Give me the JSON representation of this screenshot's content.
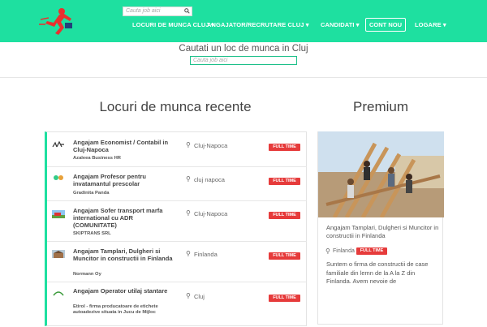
{
  "header": {
    "logo": "logo-runner-icon",
    "search_placeholder": "Cauta job aici",
    "search_icon": "search-icon",
    "nav": [
      {
        "label": "LOCURI DE MUNCA CLUJ",
        "dropdown": true
      },
      {
        "label": "ANGAJATOR/RECRUTARE CLUJ",
        "dropdown": true
      },
      {
        "label": "CANDIDATI",
        "dropdown": true
      }
    ],
    "cta_label": "CONT NOU",
    "login_label": "LOGARE",
    "caret": "▾",
    "accent_color": "#1ee0a0"
  },
  "hero": {
    "title": "Cautati un loc de munca in Cluj",
    "search_placeholder": "Cauta job aici"
  },
  "recent": {
    "title": "Locuri de munca recente",
    "jobs": [
      {
        "title": "Angajam Economist / Contabil in Cluj-Napoca",
        "company": "Azaleea Business HR",
        "location": "Cluj-Napoca",
        "type": "FULL TIME"
      },
      {
        "title": "Angajam Profesor pentru invatamantul prescolar",
        "company": "Gradinita Panda",
        "location": "cluj napoca",
        "type": "FULL TIME"
      },
      {
        "title": "Angajam Sofer transport marfa international cu ADR (COMUNITATE)",
        "company": "SKIPTRANS SRL",
        "location": "Cluj-Napoca",
        "type": "FULL TIME"
      },
      {
        "title": "Angajam Tamplari, Dulgheri si Muncitor in constructii in Finlanda",
        "company": "Normann Oy",
        "location": "Finlanda",
        "type": "FULL TIME"
      },
      {
        "title": "Angajam Operator utilaj stantare",
        "company": "Etirol - firma producatoare de etichete autoadezive situata in Jucu de Mijloc",
        "location": "Cluj",
        "type": "FULL TIME"
      }
    ]
  },
  "premium": {
    "title": "Premium",
    "job_title": "Angajam Tamplari, Dulgheri si Muncitor in constructii in Finlanda",
    "location": "Finlanda",
    "type": "FULL TIME",
    "description": "Suntem o firma de constructii de case familiale din lemn de la A la Z din Finlanda. Avem nevoie de"
  },
  "icons": {
    "pin": "location-pin-icon"
  },
  "colors": {
    "badge": "#e63b3b",
    "accent": "#1ee0a0"
  }
}
